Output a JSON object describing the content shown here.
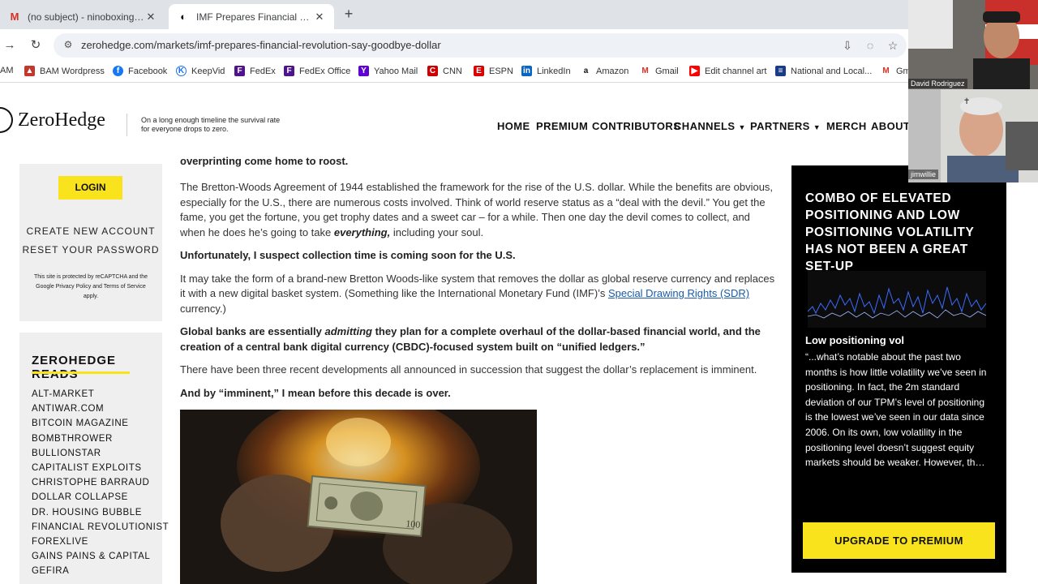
{
  "browser": {
    "tabs": [
      {
        "favicon": "gmail-icon",
        "title": "(no subject) - ninoboxing@gmail.com",
        "active": false
      },
      {
        "favicon": "zerohedge-icon",
        "title": "IMF Prepares Financial Revolution",
        "active": true
      }
    ],
    "url": "zerohedge.com/markets/imf-prepares-financial-revolution-say-goodbye-dollar",
    "bookmarks": [
      {
        "label": "AM",
        "icon": "none"
      },
      {
        "label": "BAM Wordpress",
        "icon": "bam-icon"
      },
      {
        "label": "Facebook",
        "icon": "facebook-icon"
      },
      {
        "label": "KeepVid",
        "icon": "keepvid-icon"
      },
      {
        "label": "FedEx",
        "icon": "fedex-icon"
      },
      {
        "label": "FedEx Office",
        "icon": "fedex-icon"
      },
      {
        "label": "Yahoo Mail",
        "icon": "yahoo-icon"
      },
      {
        "label": "CNN",
        "icon": "cnn-icon"
      },
      {
        "label": "ESPN",
        "icon": "espn-icon"
      },
      {
        "label": "LinkedIn",
        "icon": "linkedin-icon"
      },
      {
        "label": "Amazon",
        "icon": "amazon-icon"
      },
      {
        "label": "Gmail",
        "icon": "gmail-icon"
      },
      {
        "label": "Edit channel art",
        "icon": "youtube-icon"
      },
      {
        "label": "National and Local...",
        "icon": "news-icon"
      },
      {
        "label": "Gm",
        "icon": "gmail-icon"
      }
    ]
  },
  "site": {
    "logo": "ZeroHedge",
    "tagline": "On a long enough timeline the survival rate for everyone drops to zero.",
    "nav": [
      "HOME",
      "PREMIUM",
      "CONTRIBUTORS",
      "CHANNELS",
      "PARTNERS",
      "MERCH",
      "ABOUT"
    ],
    "accent_color": "#f8e31c"
  },
  "sidebar": {
    "login": "LOGIN",
    "create_account": "CREATE NEW ACCOUNT",
    "reset_password": "RESET YOUR PASSWORD",
    "recaptcha": "This site is protected by reCAPTCHA and the Google Privacy Policy and Terms of Service apply.",
    "reads_title": "ZEROHEDGE READS",
    "reads": [
      "ALT-MARKET",
      "ANTIWAR.COM",
      "BITCOIN MAGAZINE",
      "BOMBTHROWER",
      "BULLIONSTAR",
      "CAPITALIST EXPLOITS",
      "CHRISTOPHE BARRAUD",
      "DOLLAR COLLAPSE",
      "DR. HOUSING BUBBLE",
      "FINANCIAL REVOLUTIONIST",
      "FOREXLIVE",
      "GAINS PAINS & CAPITAL",
      "GEFIRA"
    ]
  },
  "article": {
    "cut_line": "overprinting come home to roost.",
    "p1": "The Bretton-Woods Agreement of 1944 established the framework for the rise of the U.S. dollar. While the benefits are obvious, especially for the U.S., there are numerous costs involved. Think of world reserve status as a “deal with the devil.” You get the fame, you get the fortune, you get trophy dates and a sweet car – for a while. Then one day the devil comes to collect, and when he does he’s going to take",
    "p1_em": "everything,",
    "p1_end": " including your soul.",
    "p2": "Unfortunately, I suspect collection time is coming soon for the U.S.",
    "p3": "It may take the form of a brand-new Bretton Woods-like system that removes the dollar as global reserve currency and replaces it with a new digital basket system. (Something like the International Monetary Fund (IMF)’s ",
    "p3_link": "Special Drawing Rights (SDR)",
    "p3_end": " currency.)",
    "p4_a": "Global banks are essentially ",
    "p4_em": "admitting",
    "p4_b": " they plan for a complete overhaul of the dollar-based financial world, and the creation of a central bank digital currency (CBDC)-focused system built on “unified ledgers.”",
    "p5": "There have been three recent developments all announced in succession that suggest the dollar’s replacement is imminent.",
    "p6": "And by “imminent,” I mean before this decade is over."
  },
  "ad": {
    "title": "COMBO OF ELEVATED POSITIONING AND LOW POSITIONING VOLATILITY HAS NOT BEEN A GREAT SET-UP",
    "subtitle": "Low positioning vol",
    "quote": "“...what’s notable about the past two months is how little volatility we’ve seen in positioning. In fact, the 2m standard deviation of our TPM’s level of positioning is the lowest we’ve seen in our data since 2006. On its own, low volatility in the positioning level doesn’t suggest equity markets should be weaker. However, th…",
    "button": "UPGRADE TO PREMIUM"
  },
  "webcam": {
    "names": [
      "David Rodriguez",
      "jimwillie"
    ]
  }
}
